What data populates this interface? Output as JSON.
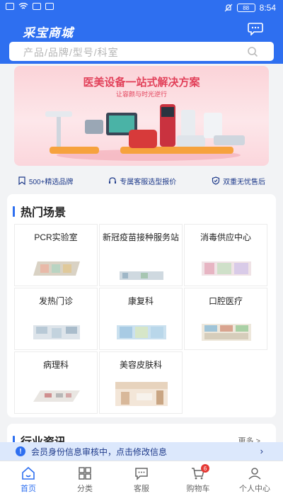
{
  "status_bar": {
    "time": "8:54",
    "battery": "88"
  },
  "header": {
    "logo": "采宝商城",
    "chat_icon": "chat-bubble-icon"
  },
  "search": {
    "placeholder": "产品/品牌/型号/科室"
  },
  "banner": {
    "title": "医美设备一站式解决方案",
    "subtitle": "让容颜与时光逆行"
  },
  "features": [
    {
      "label": "500+精选品牌",
      "icon": "bookmark-icon"
    },
    {
      "label": "专属客服选型报价",
      "icon": "headset-icon"
    },
    {
      "label": "双重无忧售后",
      "icon": "shield-icon"
    }
  ],
  "hot_scenes": {
    "title": "热门场景",
    "items": [
      {
        "label": "PCR实验室"
      },
      {
        "label": "新冠疫苗接种服务站"
      },
      {
        "label": "消毒供应中心"
      },
      {
        "label": "发热门诊"
      },
      {
        "label": "康复科"
      },
      {
        "label": "口腔医疗"
      },
      {
        "label": "病理科"
      },
      {
        "label": "美容皮肤科"
      }
    ]
  },
  "news": {
    "title": "行业资讯",
    "more": "更多 >"
  },
  "notice": {
    "text": "会员身份信息审核中，点击修改信息",
    "icon": "info-icon"
  },
  "tabbar": {
    "items": [
      {
        "label": "首页",
        "icon": "home-icon",
        "active": true
      },
      {
        "label": "分类",
        "icon": "grid-icon"
      },
      {
        "label": "客服",
        "icon": "message-icon"
      },
      {
        "label": "购物车",
        "icon": "cart-icon",
        "badge": "6"
      },
      {
        "label": "个人中心",
        "icon": "user-icon"
      }
    ]
  },
  "colors": {
    "primary": "#2e6ff0",
    "banner_accent": "#e2415a",
    "badge": "#e53935"
  }
}
